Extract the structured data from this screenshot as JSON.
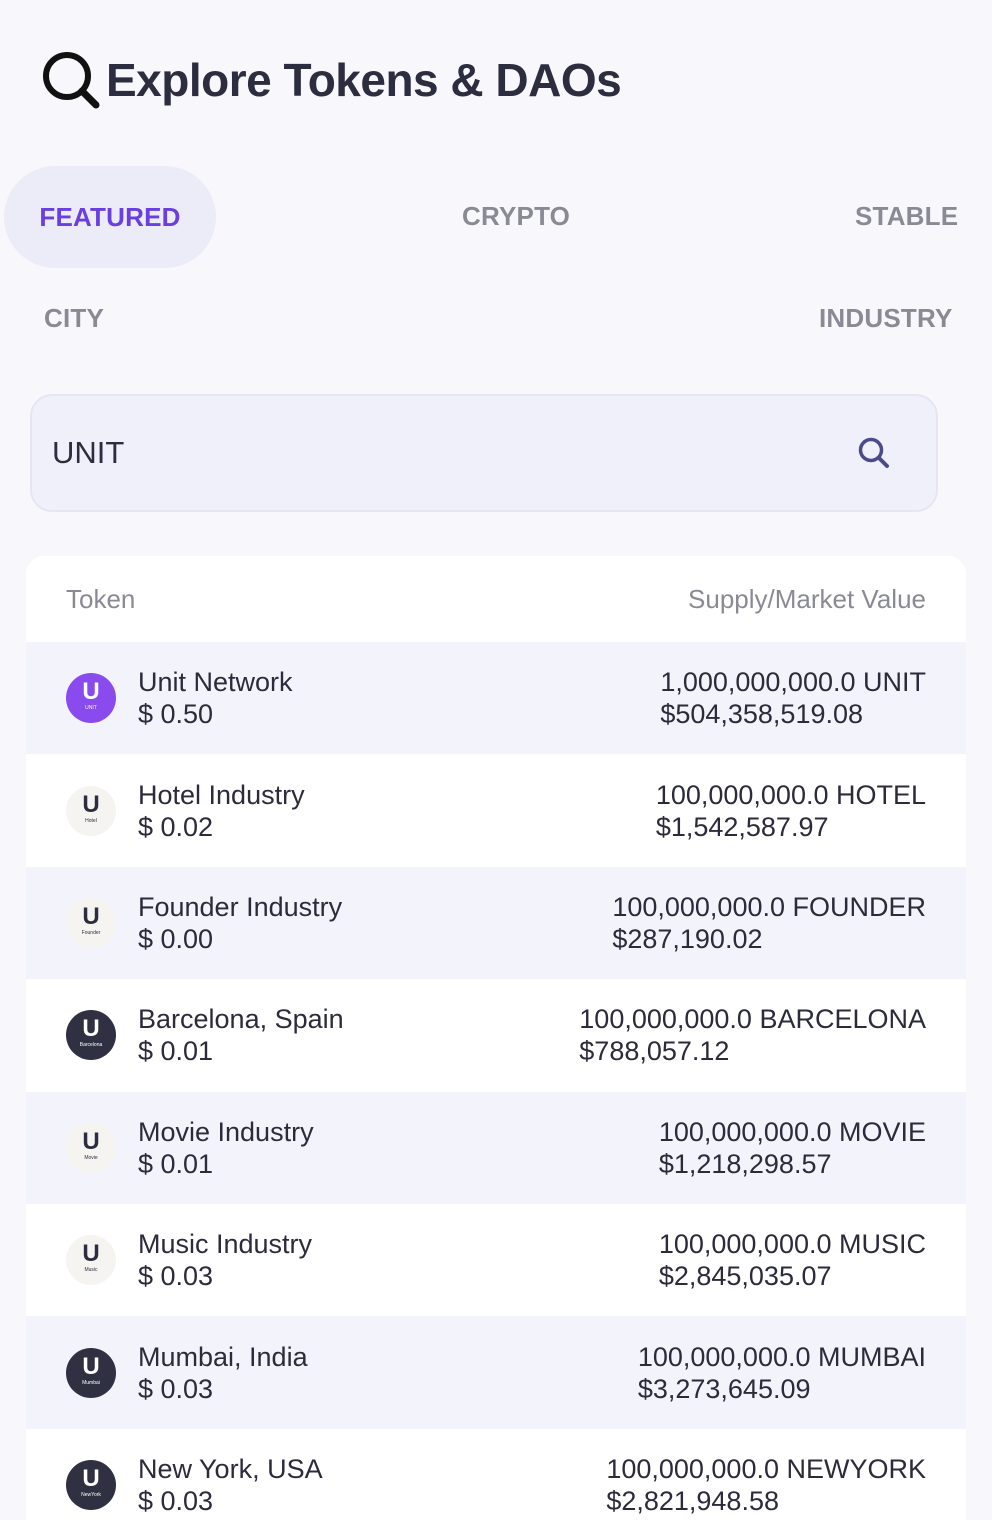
{
  "header": {
    "title": "Explore Tokens & DAOs",
    "icon": "search-icon"
  },
  "tabs": {
    "featured": "FEATURED",
    "crypto": "CRYPTO",
    "stable": "STABLE",
    "city": "CITY",
    "industry": "INDUSTRY",
    "active": "featured"
  },
  "search": {
    "value": "UNIT",
    "icon": "search-icon"
  },
  "table": {
    "headers": {
      "token": "Token",
      "value": "Supply/Market Value"
    },
    "rows": [
      {
        "name": "Unit Network",
        "price": "$ 0.50",
        "supply": "1,000,000,000.0 UNIT",
        "market": "$504,358,519.08",
        "logo_sub": "UNIT"
      },
      {
        "name": "Hotel Industry",
        "price": "$ 0.02",
        "supply": "100,000,000.0 HOTEL",
        "market": "$1,542,587.97",
        "logo_sub": "Hotel"
      },
      {
        "name": "Founder Industry",
        "price": "$ 0.00",
        "supply": "100,000,000.0 FOUNDER",
        "market": "$287,190.02",
        "logo_sub": "Founder"
      },
      {
        "name": "Barcelona, Spain",
        "price": "$ 0.01",
        "supply": "100,000,000.0 BARCELONA",
        "market": "$788,057.12",
        "logo_sub": "Barcelona"
      },
      {
        "name": "Movie Industry",
        "price": "$ 0.01",
        "supply": "100,000,000.0 MOVIE",
        "market": "$1,218,298.57",
        "logo_sub": "Movie"
      },
      {
        "name": "Music Industry",
        "price": "$ 0.03",
        "supply": "100,000,000.0 MUSIC",
        "market": "$2,845,035.07",
        "logo_sub": "Music"
      },
      {
        "name": "Mumbai, India",
        "price": "$ 0.03",
        "supply": "100,000,000.0 MUMBAI",
        "market": "$3,273,645.09",
        "logo_sub": "Mumbai"
      },
      {
        "name": "New York, USA",
        "price": "$ 0.03",
        "supply": "100,000,000.0 NEWYORK",
        "market": "$2,821,948.58",
        "logo_sub": "NewYork"
      }
    ]
  },
  "colors": {
    "accent": "#6a3fe0",
    "active_tab_bg": "#ecebf8",
    "text": "#2b2b3c",
    "muted": "#8a8a95"
  }
}
